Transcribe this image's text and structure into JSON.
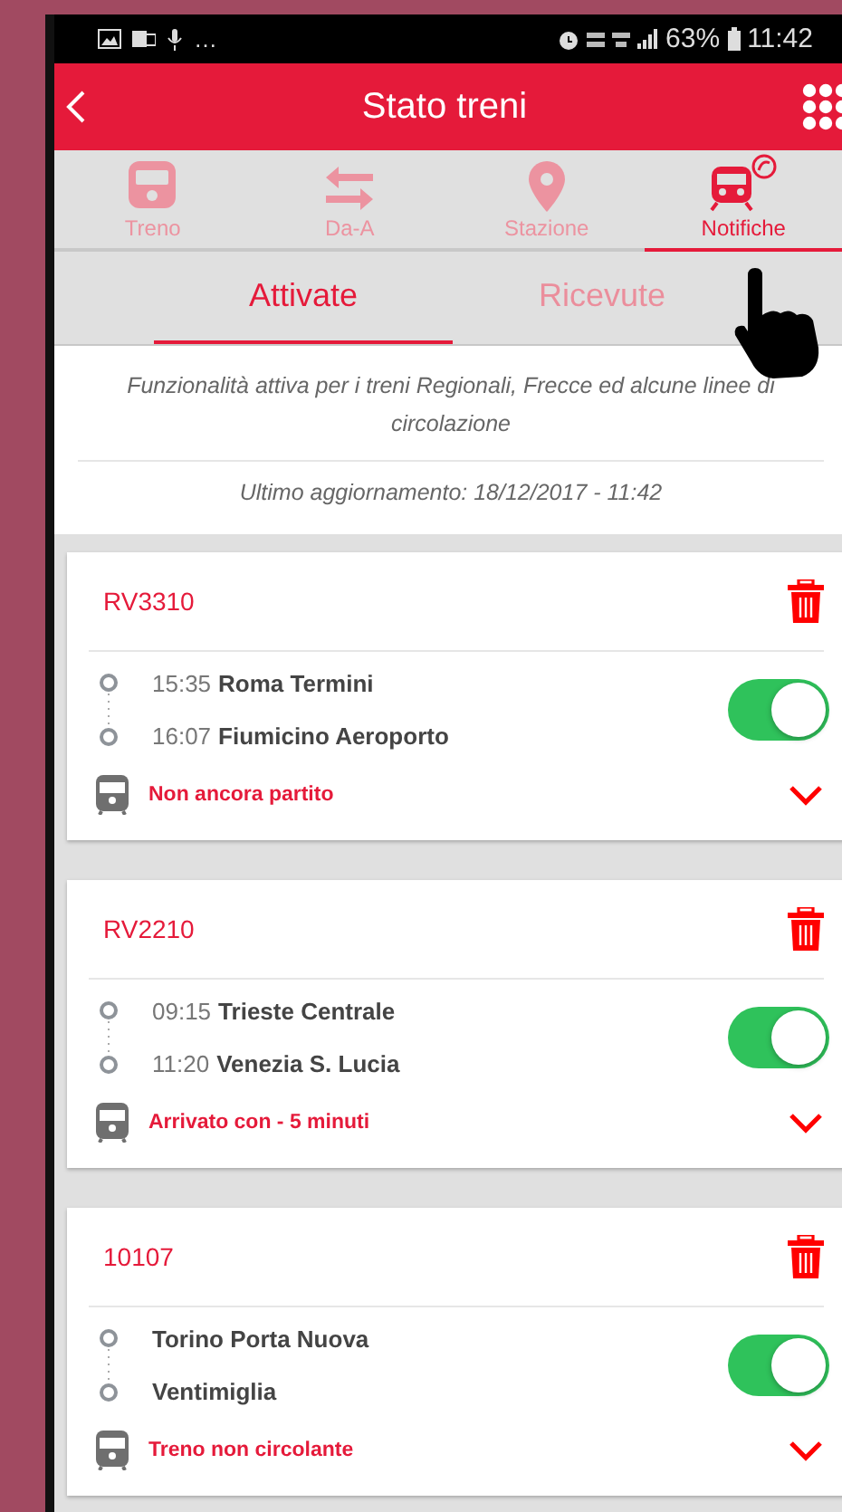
{
  "status_bar": {
    "more": "…",
    "battery": "63%",
    "time": "11:42"
  },
  "header": {
    "title": "Stato treni"
  },
  "tabs": [
    {
      "label": "Treno",
      "kind": "train",
      "selected": false
    },
    {
      "label": "Da-A",
      "kind": "swap",
      "selected": false
    },
    {
      "label": "Stazione",
      "kind": "pin",
      "selected": false
    },
    {
      "label": "Notifiche",
      "kind": "bell-train",
      "selected": true
    }
  ],
  "subtabs": [
    {
      "label": "Attivate",
      "selected": true
    },
    {
      "label": "Ricevute",
      "selected": false
    }
  ],
  "info": {
    "note": "Funzionalità attiva per i treni Regionali, Frecce ed alcune linee di circolazione",
    "updated": "Ultimo aggiornamento: 18/12/2017 - 11:42"
  },
  "trains": [
    {
      "code": "RV3310",
      "stops": [
        {
          "time": "15:35",
          "name": "Roma Termini"
        },
        {
          "time": "16:07",
          "name": "Fiumicino Aeroporto"
        }
      ],
      "on": true,
      "status": "Non ancora partito"
    },
    {
      "code": "RV2210",
      "stops": [
        {
          "time": "09:15",
          "name": "Trieste Centrale"
        },
        {
          "time": "11:20",
          "name": "Venezia S. Lucia"
        }
      ],
      "on": true,
      "status": "Arrivato con - 5 minuti"
    },
    {
      "code": "10107",
      "stops": [
        {
          "name": "Torino Porta Nuova"
        },
        {
          "name": "Ventimiglia"
        }
      ],
      "on": true,
      "status": "Treno non circolante"
    }
  ]
}
